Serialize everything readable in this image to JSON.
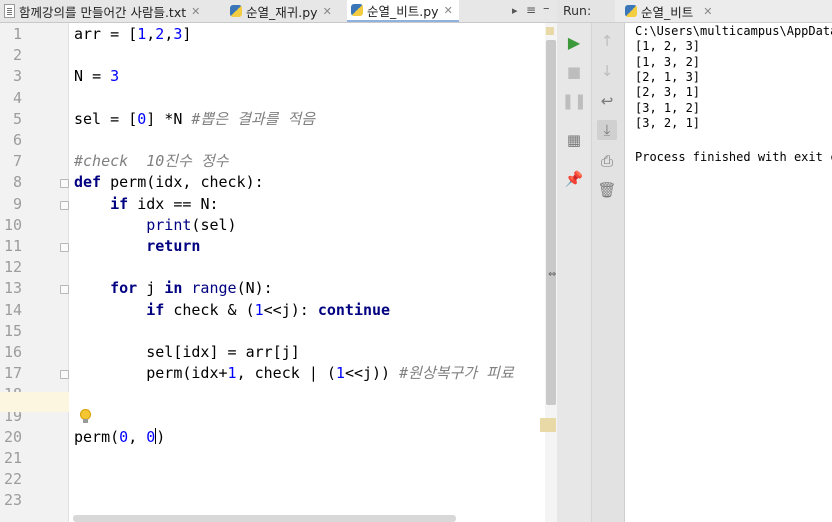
{
  "editor": {
    "tabs": [
      {
        "label": "함께강의를 만들어간 사람들.txt",
        "icon": "text-file-icon",
        "active": false
      },
      {
        "label": "순열_재귀.py",
        "icon": "python-file-icon",
        "active": false
      },
      {
        "label": "순열_비트.py",
        "icon": "python-file-icon",
        "active": true
      }
    ],
    "line_numbers": [
      "1",
      "2",
      "3",
      "4",
      "5",
      "6",
      "7",
      "8",
      "9",
      "10",
      "11",
      "12",
      "13",
      "14",
      "15",
      "16",
      "17",
      "18",
      "19",
      "20",
      "21",
      "22",
      "23"
    ],
    "code_lines": [
      "arr = [1,2,3]",
      "",
      "N = 3",
      "",
      "sel = [0] *N #뽑은 결과를 적음",
      "",
      "#check  10진수 정수",
      "def perm(idx, check):",
      "    if idx == N:",
      "        print(sel)",
      "        return",
      "",
      "    for j in range(N):",
      "        if check & (1<<j): continue",
      "",
      "        sel[idx] = arr[j]",
      "        perm(idx+1, check | (1<<j)) #원상복구가 피료",
      "",
      "",
      "perm(0, 0)",
      "",
      "",
      ""
    ],
    "current_line": 20
  },
  "run": {
    "label": "Run:",
    "tab_label": "순열_비트",
    "console_lines": [
      "C:\\Users\\multicampus\\AppData",
      "[1, 2, 3]",
      "[1, 3, 2]",
      "[2, 1, 3]",
      "[2, 3, 1]",
      "[3, 1, 2]",
      "[3, 2, 1]",
      "",
      "Process finished with exit c"
    ],
    "toolbar1": [
      "rerun-icon",
      "stop-icon",
      "pause-icon",
      "layout-icon",
      "pin-icon"
    ],
    "toolbar2": [
      "up-arrow-icon",
      "down-arrow-icon",
      "soft-wrap-icon",
      "scroll-to-end-icon",
      "print-icon",
      "trash-icon"
    ]
  },
  "colors": {
    "keyword": "#000080",
    "number": "#0000ff",
    "comment": "#808080",
    "caret_row": "#fcf6e0",
    "run_green": "#3c9a3a"
  }
}
